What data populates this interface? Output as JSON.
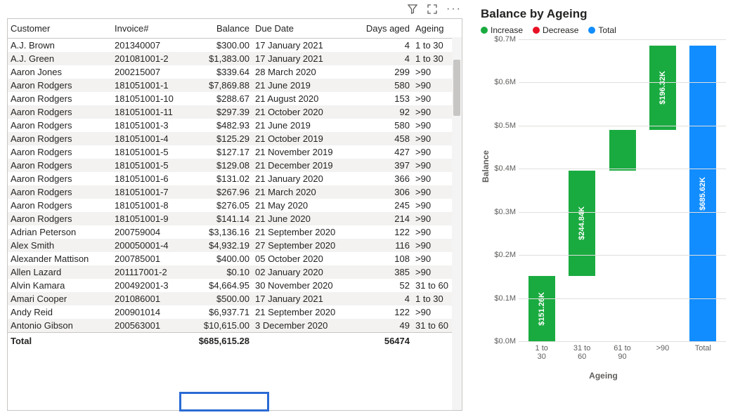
{
  "table": {
    "columns": [
      "Customer",
      "Invoice#",
      "Balance",
      "Due Date",
      "Days aged",
      "Ageing"
    ],
    "rows": [
      [
        "A.J. Brown",
        "201340007",
        "$300.00",
        "17 January 2021",
        "4",
        "1 to 30"
      ],
      [
        "A.J. Green",
        "201081001-2",
        "$1,383.00",
        "17 January 2021",
        "4",
        "1 to 30"
      ],
      [
        "Aaron Jones",
        "200215007",
        "$339.64",
        "28 March 2020",
        "299",
        ">90"
      ],
      [
        "Aaron Rodgers",
        "181051001-1",
        "$7,869.88",
        "21 June 2019",
        "580",
        ">90"
      ],
      [
        "Aaron Rodgers",
        "181051001-10",
        "$288.67",
        "21 August 2020",
        "153",
        ">90"
      ],
      [
        "Aaron Rodgers",
        "181051001-11",
        "$297.39",
        "21 October 2020",
        "92",
        ">90"
      ],
      [
        "Aaron Rodgers",
        "181051001-3",
        "$482.93",
        "21 June 2019",
        "580",
        ">90"
      ],
      [
        "Aaron Rodgers",
        "181051001-4",
        "$125.29",
        "21 October 2019",
        "458",
        ">90"
      ],
      [
        "Aaron Rodgers",
        "181051001-5",
        "$127.17",
        "21 November 2019",
        "427",
        ">90"
      ],
      [
        "Aaron Rodgers",
        "181051001-5",
        "$129.08",
        "21 December 2019",
        "397",
        ">90"
      ],
      [
        "Aaron Rodgers",
        "181051001-6",
        "$131.02",
        "21 January 2020",
        "366",
        ">90"
      ],
      [
        "Aaron Rodgers",
        "181051001-7",
        "$267.96",
        "21 March 2020",
        "306",
        ">90"
      ],
      [
        "Aaron Rodgers",
        "181051001-8",
        "$276.05",
        "21 May 2020",
        "245",
        ">90"
      ],
      [
        "Aaron Rodgers",
        "181051001-9",
        "$141.14",
        "21 June 2020",
        "214",
        ">90"
      ],
      [
        "Adrian Peterson",
        "200759004",
        "$3,136.16",
        "21 September 2020",
        "122",
        ">90"
      ],
      [
        "Alex Smith",
        "200050001-4",
        "$4,932.19",
        "27 September 2020",
        "116",
        ">90"
      ],
      [
        "Alexander Mattison",
        "200785001",
        "$400.00",
        "05 October 2020",
        "108",
        ">90"
      ],
      [
        "Allen Lazard",
        "201117001-2",
        "$0.10",
        "02 January 2020",
        "385",
        ">90"
      ],
      [
        "Alvin Kamara",
        "200492001-3",
        "$4,664.95",
        "30 November 2020",
        "52",
        "31 to 60"
      ],
      [
        "Amari Cooper",
        "201086001",
        "$500.00",
        "17 January 2021",
        "4",
        "1 to 30"
      ],
      [
        "Andy Reid",
        "200901014",
        "$6,937.71",
        "21 September 2020",
        "122",
        ">90"
      ],
      [
        "Antonio Gibson",
        "200563001",
        "$10,615.00",
        "3 December 2020",
        "49",
        "31 to 60"
      ]
    ],
    "total": {
      "label": "Total",
      "balance": "$685,615.28",
      "days": "56474"
    }
  },
  "chart": {
    "title": "Balance by Ageing",
    "legend": {
      "inc": "Increase",
      "dec": "Decrease",
      "tot": "Total"
    },
    "ylabel": "Balance",
    "xlabel": "Ageing"
  },
  "chart_data": {
    "type": "waterfall",
    "title": "Balance by Ageing",
    "xlabel": "Ageing",
    "ylabel": "Balance",
    "ylim": [
      0,
      700000
    ],
    "y_ticks": [
      "$0.0M",
      "$0.1M",
      "$0.2M",
      "$0.3M",
      "$0.4M",
      "$0.5M",
      "$0.6M",
      "$0.7M"
    ],
    "categories": [
      "1 to 30",
      "31 to 60",
      "61 to 90",
      ">90",
      "Total"
    ],
    "bars": [
      {
        "kind": "increase",
        "start": 0,
        "end": 151260,
        "label": "$151.26K"
      },
      {
        "kind": "increase",
        "start": 151260,
        "end": 396100,
        "label": "$244.84K"
      },
      {
        "kind": "increase",
        "start": 396100,
        "end": 489300,
        "label": ""
      },
      {
        "kind": "increase",
        "start": 489300,
        "end": 685620,
        "label": "$196.32K"
      },
      {
        "kind": "total",
        "start": 0,
        "end": 685620,
        "label": "$685.62K"
      }
    ],
    "legend": [
      "Increase",
      "Decrease",
      "Total"
    ]
  }
}
